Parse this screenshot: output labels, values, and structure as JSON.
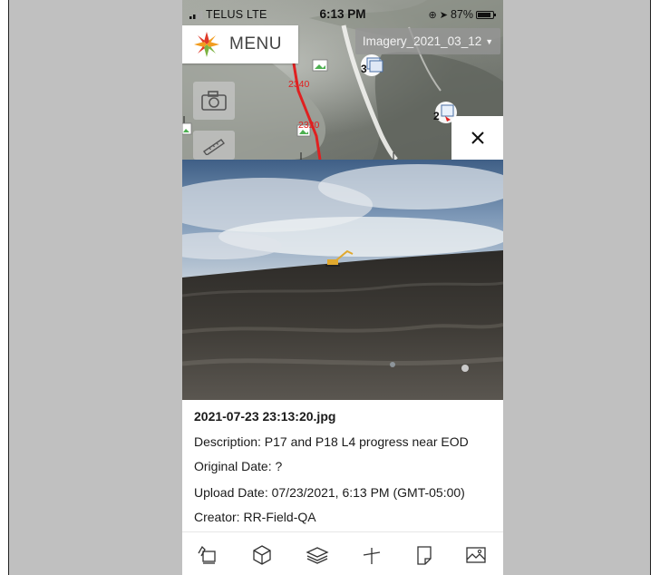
{
  "status_bar": {
    "carrier": "TELUS  LTE",
    "time": "6:13 PM",
    "battery": "87%"
  },
  "map": {
    "menu_label": "MENU",
    "imagery_dropdown": "Imagery_2021_03_12",
    "station_labels": [
      "2340",
      "2320"
    ],
    "cluster_counts": [
      "3",
      "2"
    ],
    "route_color": "#e02020"
  },
  "photo": {
    "filename": "2021-07-23 23:13:20.jpg",
    "description": "Description: P17 and P18 L4 progress near EOD",
    "original_date": "Original Date: ?",
    "upload_date": "Upload Date: 07/23/2021, 6:13 PM (GMT-05:00)",
    "creator": "Creator: RR-Field-QA"
  },
  "toolbar": {
    "icons": [
      "survey-tool-icon",
      "cube-icon",
      "layers-icon",
      "measure-icon",
      "document-icon",
      "image-icon"
    ]
  },
  "colors": {
    "brand_orange": "#f29c1f",
    "brand_green": "#7cb342",
    "brand_red": "#e03a2a"
  }
}
